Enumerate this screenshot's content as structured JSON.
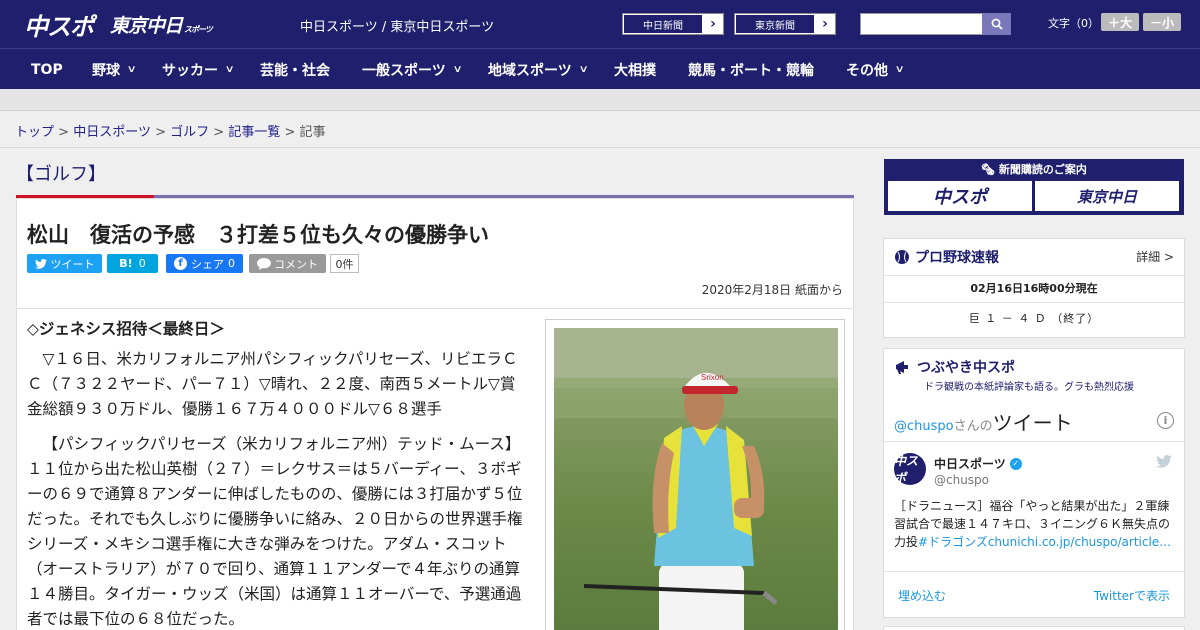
{
  "header": {
    "logo_chuspo": "中スポ",
    "logo_tokyo": "東京中日",
    "logo_tokyo_small": "スポーツ",
    "site_links": "中日スポーツ / 東京中日スポーツ",
    "newspaper1": "中日新聞",
    "newspaper2": "東京新聞",
    "arrow": "›",
    "font_size_label": "文字（0）",
    "font_up": "＋大",
    "font_down": "－小"
  },
  "nav": [
    {
      "label": "TOP",
      "has_menu": false
    },
    {
      "label": "野球",
      "has_menu": true
    },
    {
      "label": "サッカー",
      "has_menu": true
    },
    {
      "label": "芸能・社会",
      "has_menu": false
    },
    {
      "label": "一般スポーツ",
      "has_menu": true
    },
    {
      "label": "地域スポーツ",
      "has_menu": true
    },
    {
      "label": "大相撲",
      "has_menu": false
    },
    {
      "label": "競馬・ボート・競輪",
      "has_menu": false
    },
    {
      "label": "その他",
      "has_menu": true
    }
  ],
  "breadcrumb": {
    "items": [
      "トップ",
      "中日スポーツ",
      "ゴルフ",
      "記事一覧"
    ],
    "current": "記事",
    "separator": ">"
  },
  "article": {
    "category": "【ゴルフ】",
    "title": "松山　復活の予感　３打差５位も久々の優勝争い",
    "share": {
      "tweet": "ツイート",
      "hatena": "B!",
      "hatena_count": "0",
      "fb_share": "シェア",
      "fb_count": "0",
      "comment": "コメント",
      "comment_count": "0件"
    },
    "date": "2020年2月18日 紙面から",
    "lead": "◇ジェネシス招待＜最終日＞",
    "paragraphs": [
      "▽１６日、米カリフォルニア州パシフィックパリセーズ、リビエラＣＣ（７３２２ヤード、パー７１）▽晴れ、２２度、南西５メートル▽賞金総額９３０万ドル、優勝１６７万４０００ドル▽６８選手",
      "【パシフィックパリセーズ（米カリフォルニア州）テッド・ムース】１１位から出た松山英樹（２７）＝レクサス＝は５バーディー、３ボギーの６９で通算８アンダーに伸ばしたものの、優勝には３打届かず５位だった。それでも久しぶりに優勝争いに絡み、２０日からの世界選手権シリーズ・メキシコ選手権に大きな弾みをつけた。アダム・スコット（オーストラリア）が７０で回り、通算１１アンダーで４年ぶりの通算１４勝目。タイガー・ウッズ（米国）は通算１１オーバーで、予選通過者では最下位の６８位だった。"
    ]
  },
  "sidebar": {
    "promo_label": "新聞購読のご案内",
    "promo_chuspo": "中スポ",
    "promo_tokyo": "東京中日",
    "baseball": {
      "title": "プロ野球速報",
      "detail": "詳細 >",
      "time": "02月16日16時00分現在",
      "score": "巨 １ － ４ Ｄ （終了）"
    },
    "tweet": {
      "title": "つぶやき中スポ",
      "subtitle": "ドラ観戦の本紙評論家も語る。グラも熱烈応援",
      "by_handle": "@chuspo",
      "by_suffix": "さんの",
      "by_word": "ツイート",
      "account_name": "中日スポーツ",
      "account_handle": "@chuspo",
      "avatar_text": "中スポ",
      "text": "［ドラニュース］福谷「やっと結果が出た」２軍練習試合で最速１４７キロ、３イニング６Ｋ無失点の力投",
      "text_link": "#ドラゴンズchunichi.co.jp/chuspo/article…",
      "embed": "埋め込む",
      "view": "Twitterで表示"
    }
  },
  "colors": {
    "brand": "#1f1f6e",
    "accent_red": "#d0112b",
    "twitter": "#1da1f2",
    "facebook": "#1877f2",
    "hatena": "#00a4de"
  }
}
